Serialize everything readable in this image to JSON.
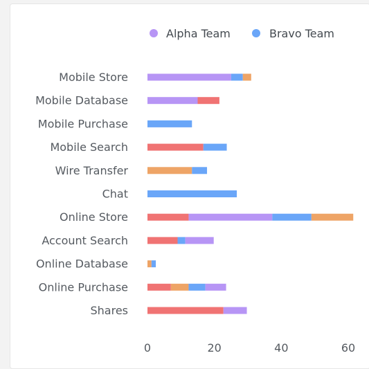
{
  "chart_data": {
    "type": "bar",
    "orientation": "horizontal",
    "stacked": true,
    "categories": [
      "Mobile Store",
      "Mobile Database",
      "Mobile Purchase",
      "Mobile Search",
      "Wire Transfer",
      "Chat",
      "Online Store",
      "Account Search",
      "Online Database",
      "Online Purchase",
      "Shares"
    ],
    "legend": [
      {
        "name": "Alpha Team",
        "color": "#b795f5"
      },
      {
        "name": "Bravo Team",
        "color": "#6aa6f8"
      }
    ],
    "legend_position": "top-right",
    "colors": {
      "red": "#f07373",
      "purple": "#b795f5",
      "blue": "#6aa6f8",
      "orange": "#eea466"
    },
    "rows": [
      [
        {
          "color": "purple",
          "value": 25
        },
        {
          "color": "blue",
          "value": 3.5
        },
        {
          "color": "orange",
          "value": 2.5
        }
      ],
      [
        {
          "color": "purple",
          "value": 15
        },
        {
          "color": "red",
          "value": 6.5
        }
      ],
      [
        {
          "color": "blue",
          "value": 13.3
        }
      ],
      [
        {
          "color": "red",
          "value": 16.7
        },
        {
          "color": "blue",
          "value": 7
        }
      ],
      [
        {
          "color": "orange",
          "value": 13.3
        },
        {
          "color": "blue",
          "value": 4.5
        }
      ],
      [
        {
          "color": "blue",
          "value": 26.7
        }
      ],
      [
        {
          "color": "red",
          "value": 12.3
        },
        {
          "color": "purple",
          "value": 25
        },
        {
          "color": "blue",
          "value": 11.7
        },
        {
          "color": "orange",
          "value": 12.5
        }
      ],
      [
        {
          "color": "red",
          "value": 9
        },
        {
          "color": "blue",
          "value": 2.3
        },
        {
          "color": "purple",
          "value": 8.5
        }
      ],
      [
        {
          "color": "orange",
          "value": 1.2
        },
        {
          "color": "blue",
          "value": 1.3
        }
      ],
      [
        {
          "color": "red",
          "value": 7
        },
        {
          "color": "orange",
          "value": 5.3
        },
        {
          "color": "blue",
          "value": 5
        },
        {
          "color": "purple",
          "value": 6.2
        }
      ],
      [
        {
          "color": "red",
          "value": 22.7
        },
        {
          "color": "purple",
          "value": 7
        }
      ]
    ],
    "xlim": [
      0,
      61
    ],
    "xticks": [
      0,
      20,
      40,
      60
    ],
    "grid": false
  }
}
